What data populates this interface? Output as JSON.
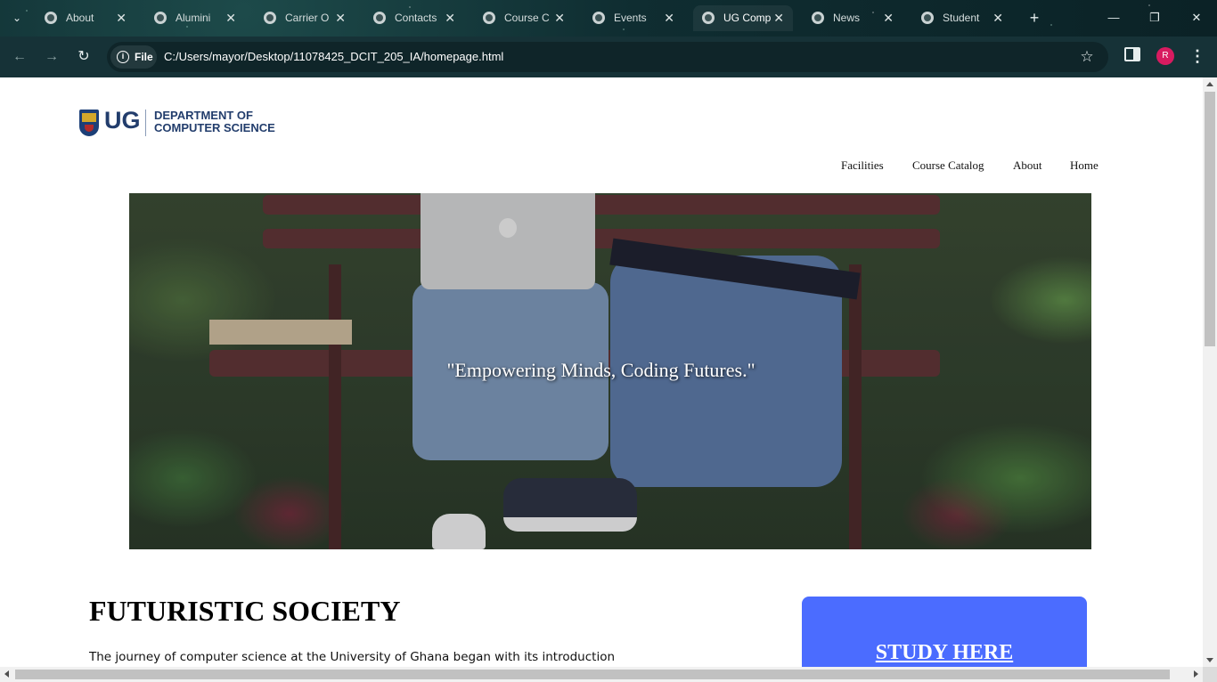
{
  "browser": {
    "tabs": [
      {
        "title": "About",
        "active": false
      },
      {
        "title": "Alumini",
        "active": false
      },
      {
        "title": "Carrier O",
        "active": false
      },
      {
        "title": "Contacts",
        "active": false
      },
      {
        "title": "Course C",
        "active": false
      },
      {
        "title": "Events",
        "active": false
      },
      {
        "title": "UG Comp",
        "active": true
      },
      {
        "title": "News",
        "active": false
      },
      {
        "title": "Student",
        "active": false
      }
    ],
    "close_glyph": "✕",
    "new_tab_glyph": "+",
    "chip_label": "File",
    "url": "C:/Users/mayor/Desktop/11078425_DCIT_205_IA/homepage.html",
    "profile_initial": "R",
    "profile_color": "#d81b60",
    "icons": [
      "tab-search-icon",
      "globe-icon",
      "close-icon",
      "new-tab-icon",
      "minimize-icon",
      "maximize-icon",
      "window-close-icon",
      "back-icon",
      "forward-icon",
      "reload-icon",
      "info-icon",
      "star-icon",
      "side-panel-icon",
      "menu-icon"
    ]
  },
  "page": {
    "logo": {
      "ug": "UG",
      "line1": "DEPARTMENT OF",
      "line2": "COMPUTER SCIENCE"
    },
    "nav": [
      "Facilities",
      "Course Catalog",
      "About",
      "Home"
    ],
    "hero_quote": "\"Empowering Minds, Coding Futures.\"",
    "section_title": "FUTURISTIC SOCIETY",
    "section_text": "The journey of computer science at the University of Ghana began with its introduction",
    "study_link": "STUDY HERE",
    "accent_color": "#4b6cff"
  }
}
